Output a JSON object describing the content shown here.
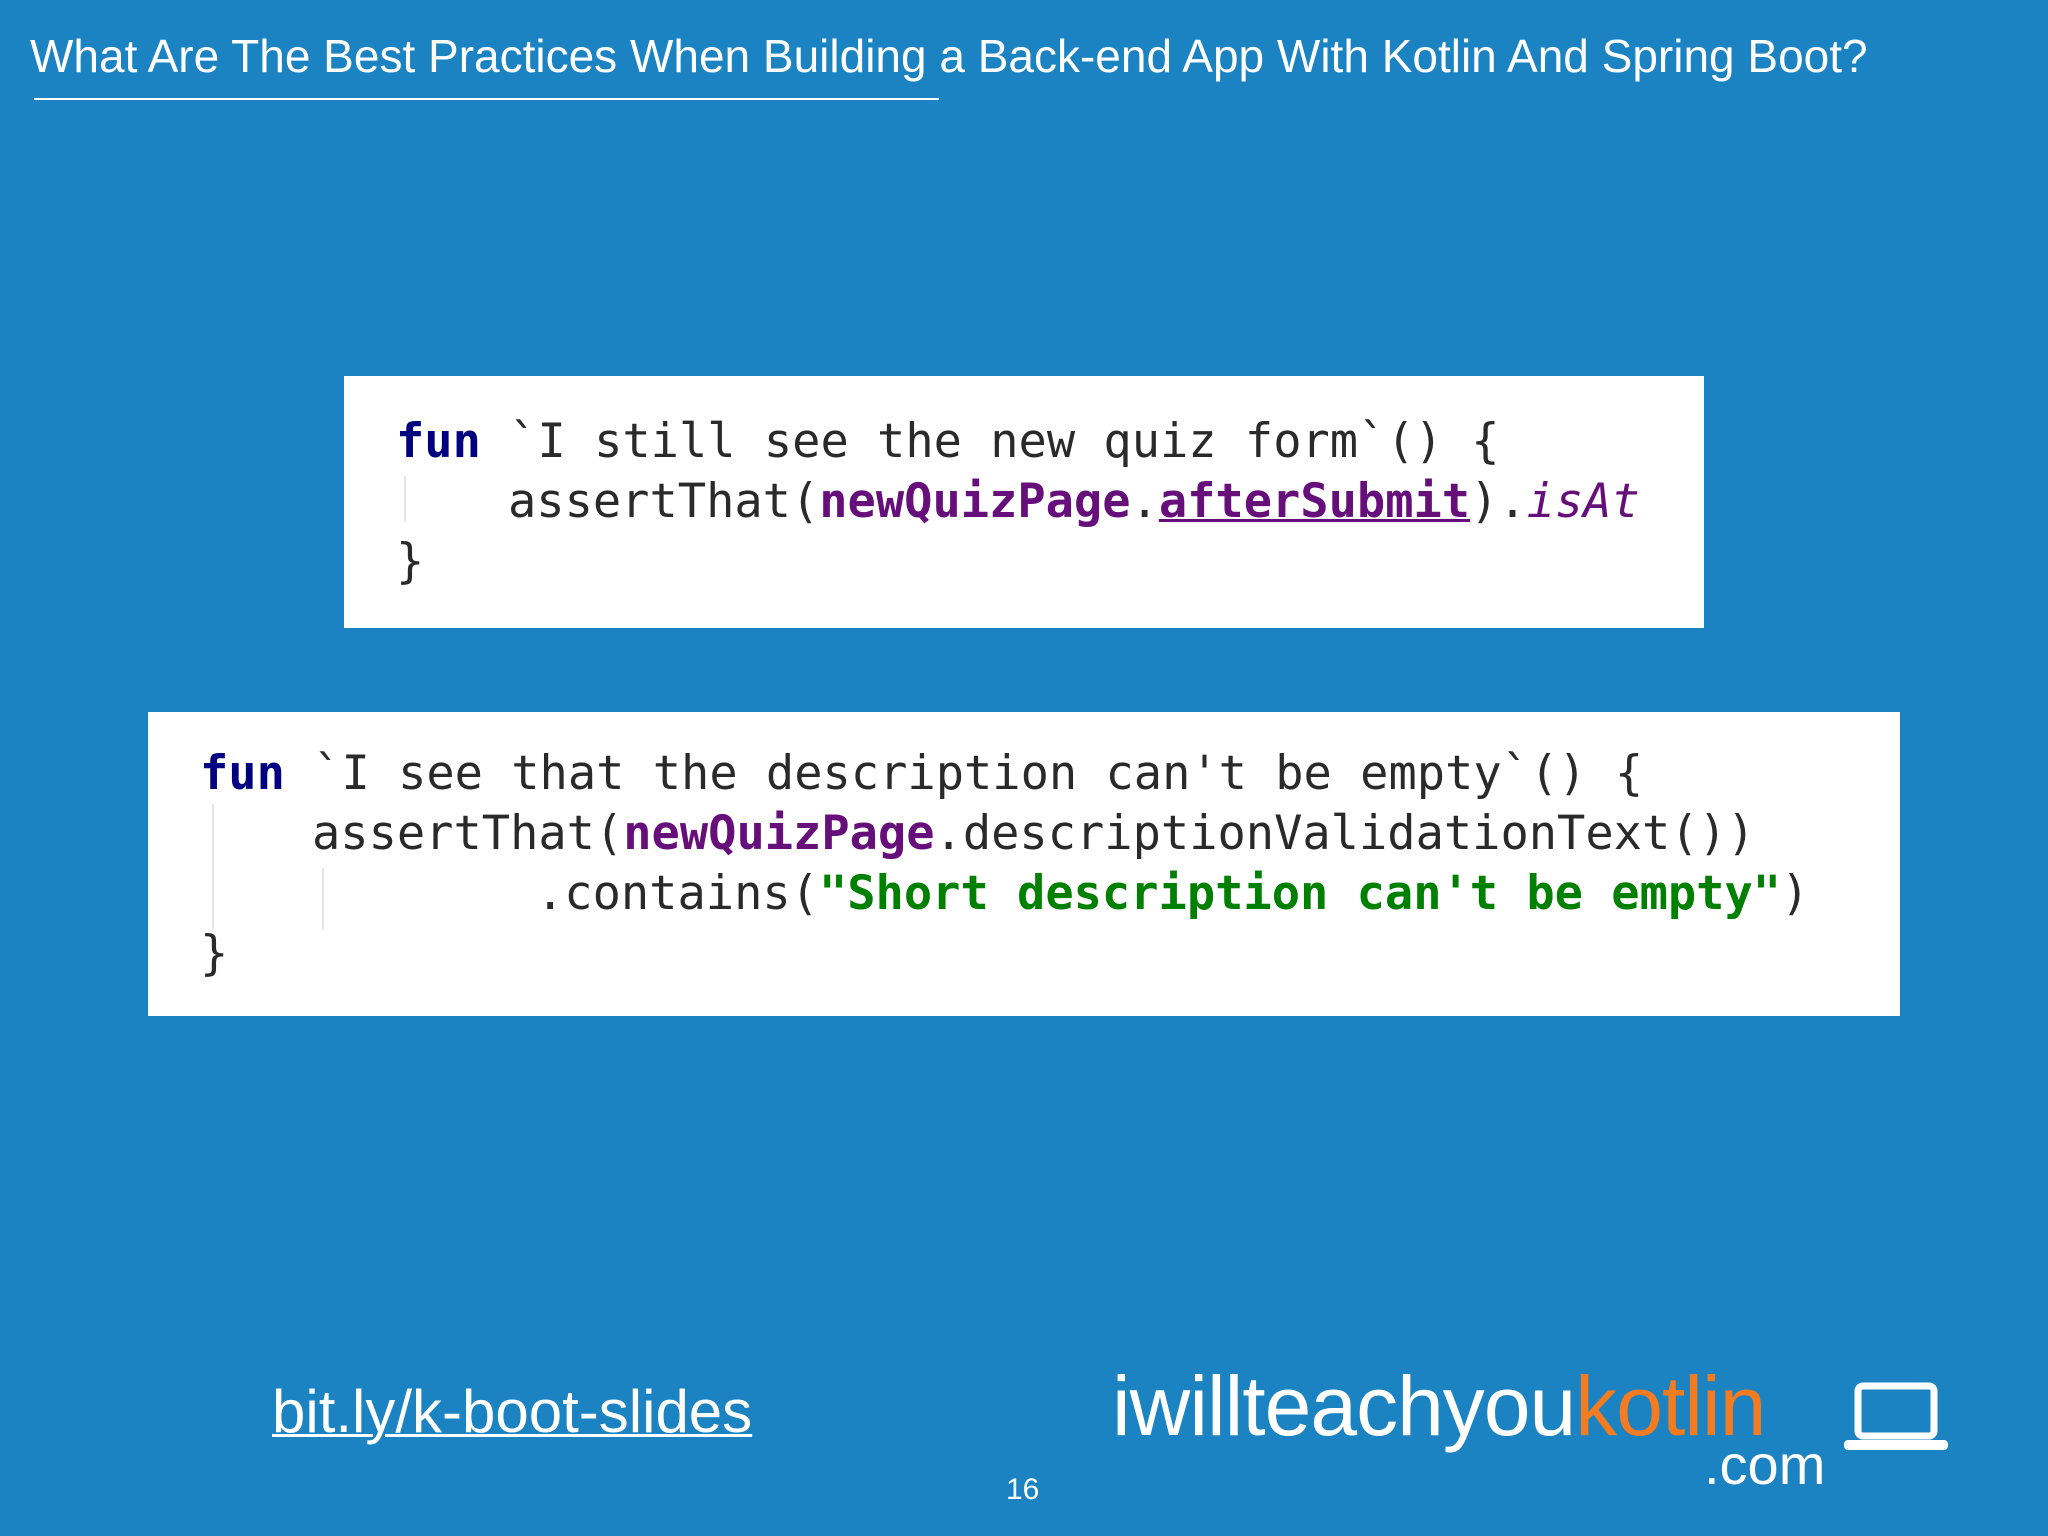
{
  "slide": {
    "title": "What Are The Best Practices When Building a Back-end App With Kotlin And Spring Boot?",
    "page_number": "16",
    "link": "bit.ly/k-boot-slides"
  },
  "logo": {
    "part1": "iwillteachyou",
    "part2": "kotlin",
    "domain": ".com",
    "icon": "laptop-icon"
  },
  "snippet1": {
    "line1_keyword": "fun",
    "line1_rest": " `I still see the new quiz form`() {",
    "line2_start": "assertThat(",
    "line2_ident": "newQuizPage",
    "line2_dot": ".",
    "line2_property": "afterSubmit",
    "line2_close": ").",
    "line2_call": "isAt",
    "line3": "}"
  },
  "snippet2": {
    "line1_keyword": "fun",
    "line1_rest": " `I see that the description can't be empty`() {",
    "line2_start": "assertThat(",
    "line2_ident": "newQuizPage",
    "line2_rest": ".descriptionValidationText())",
    "line3_start": ".contains(",
    "line3_string": "\"Short description can't be empty\"",
    "line3_close": ")",
    "line4": "}"
  },
  "colors": {
    "background": "#1b83c1",
    "keyword": "#000080",
    "identifier": "#660e7a",
    "string": "#008000",
    "logo_accent": "#f47b20"
  }
}
